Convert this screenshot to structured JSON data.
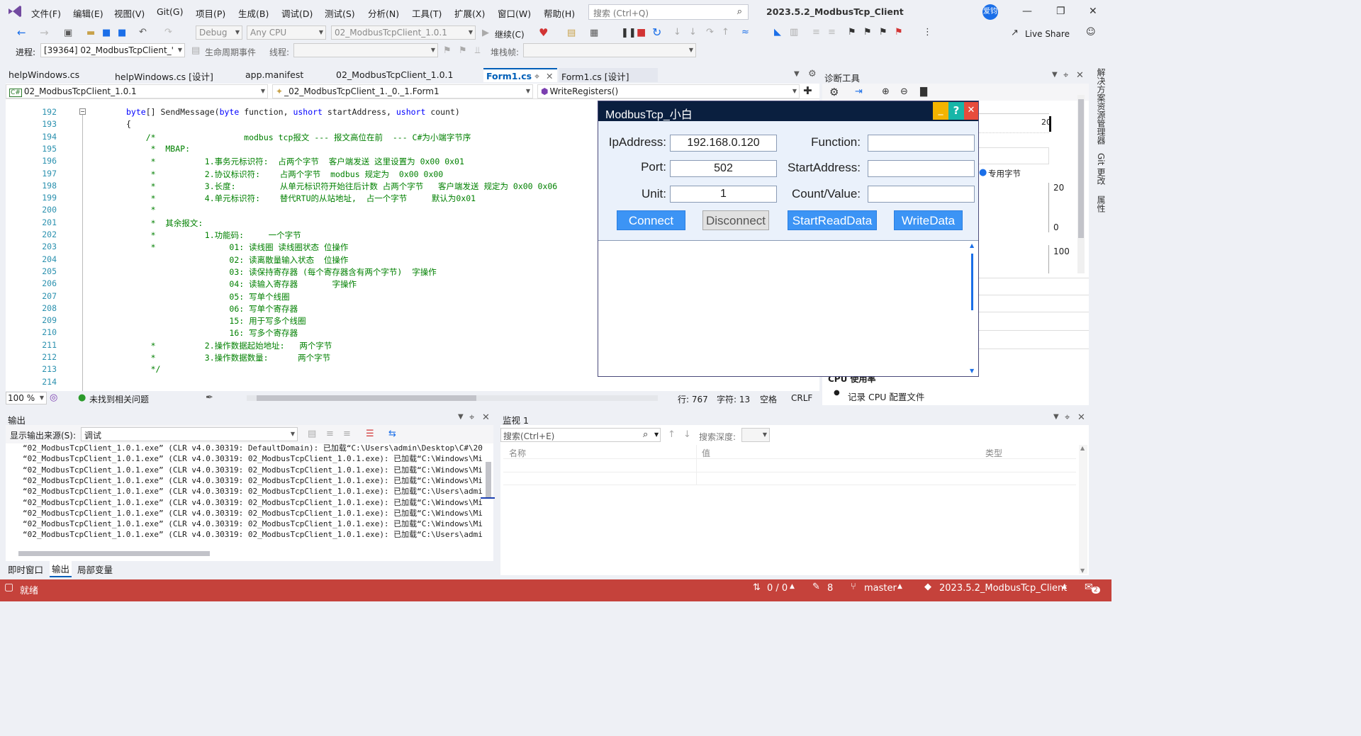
{
  "menu": [
    "文件(F)",
    "编辑(E)",
    "视图(V)",
    "Git(G)",
    "项目(P)",
    "生成(B)",
    "调试(D)",
    "测试(S)",
    "分析(N)",
    "工具(T)",
    "扩展(X)",
    "窗口(W)",
    "帮助(H)"
  ],
  "search_placeholder": "搜索 (Ctrl+Q)",
  "app_title": "2023.5.2_ModbusTcp_Client",
  "avatar": "爱钧",
  "toolbar": {
    "debug": "Debug",
    "cpu": "Any CPU",
    "project": "02_ModbusTcpClient_1.0.1",
    "continue": "继续(C)",
    "live_share": "Live Share",
    "process_label": "进程:",
    "process": "[39364] 02_ModbusTcpClient_'",
    "lifecycle": "生命周期事件",
    "thread_label": "线程:",
    "stack_label": "堆栈帧:"
  },
  "tabs": [
    "helpWindows.cs",
    "helpWindows.cs [设计]",
    "app.manifest",
    "02_ModbusTcpClient_1.0.1",
    "Form1.cs",
    "Form1.cs [设计]"
  ],
  "nav": {
    "project": "02_ModbusTcpClient_1.0.1",
    "class": "_02_ModbusTcpClient_1._0._1.Form1",
    "method": "WriteRegisters()"
  },
  "code": [
    {
      "n": "192",
      "t": "byte[] SendMessage(byte function, ushort startAddress, ushort count)"
    },
    {
      "n": "193",
      "t": "{"
    },
    {
      "n": "194",
      "t": "    /*                  modbus tcp报文 --- 报文高位在前  --- C#为小端字节序"
    },
    {
      "n": "195",
      "t": "     *  MBAP:"
    },
    {
      "n": "196",
      "t": "     *          1.事务元标识符:  占两个字节  客户端发送 这里设置为 0x00 0x01"
    },
    {
      "n": "197",
      "t": "     *          2.协议标识符:    占两个字节  modbus 规定为  0x00 0x00"
    },
    {
      "n": "198",
      "t": "     *          3.长度:         从单元标识符开始往后计数 占两个字节   客户端发送 规定为 0x00 0x06"
    },
    {
      "n": "199",
      "t": "     *          4.单元标识符:    替代RTU的从站地址,  占一个字节     默认为0x01"
    },
    {
      "n": "200",
      "t": "     *"
    },
    {
      "n": "201",
      "t": "     *  其余报文:"
    },
    {
      "n": "202",
      "t": "     *          1.功能码:     一个字节"
    },
    {
      "n": "203",
      "t": "     *               01: 读线圈 读线圈状态 位操作"
    },
    {
      "n": "204",
      "t": "                     02: 读离散量输入状态  位操作"
    },
    {
      "n": "205",
      "t": "                     03: 读保持寄存器 (每个寄存器含有两个字节)  字操作"
    },
    {
      "n": "206",
      "t": "                     04: 读输入寄存器       字操作"
    },
    {
      "n": "207",
      "t": "                     05: 写单个线圈"
    },
    {
      "n": "208",
      "t": "                     06: 写单个寄存器"
    },
    {
      "n": "209",
      "t": "                     15: 用于写多个线圈"
    },
    {
      "n": "210",
      "t": "                     16: 写多个寄存器"
    },
    {
      "n": "211",
      "t": "     *          2.操作数据起始地址:   两个字节"
    },
    {
      "n": "212",
      "t": "     *          3.操作数据数量:      两个字节"
    },
    {
      "n": "213",
      "t": "     */"
    },
    {
      "n": "214",
      "t": ""
    }
  ],
  "editor_status": {
    "zoom": "100 %",
    "issues": "未找到相关问题",
    "line": "行: 767",
    "char": "字符: 13",
    "space": "空格",
    "eol": "CRLF"
  },
  "diag": {
    "title": "诊断工具",
    "tick1": "20",
    "tick2": "20",
    "tick3": "0",
    "tick4": "100",
    "legend": "专用字节",
    "cpu_usage": "CPU 使用率",
    "record": "记录 CPU 配置文件"
  },
  "dialog": {
    "title": "ModbusTcp_小白",
    "labels": {
      "ip": "IpAddress:",
      "port": "Port:",
      "unit": "Unit:",
      "function": "Function:",
      "start": "StartAddress:",
      "count": "Count/Value:"
    },
    "values": {
      "ip": "192.168.0.120",
      "port": "502",
      "unit": "1",
      "function": "",
      "start": "",
      "count": ""
    },
    "buttons": {
      "connect": "Connect",
      "disconnect": "Disconnect",
      "read": "StartReadData",
      "write": "WriteData"
    }
  },
  "output": {
    "title": "输出",
    "source_label": "显示输出来源(S):",
    "source": "调试",
    "lines": [
      "“02_ModbusTcpClient_1.0.1.exe” (CLR v4.0.30319: DefaultDomain): 已加载“C:\\Users\\admin\\Desktop\\C#\\20",
      "“02_ModbusTcpClient_1.0.1.exe” (CLR v4.0.30319: 02_ModbusTcpClient_1.0.1.exe): 已加载“C:\\Windows\\Mi",
      "“02_ModbusTcpClient_1.0.1.exe” (CLR v4.0.30319: 02_ModbusTcpClient_1.0.1.exe): 已加载“C:\\Windows\\Mi",
      "“02_ModbusTcpClient_1.0.1.exe” (CLR v4.0.30319: 02_ModbusTcpClient_1.0.1.exe): 已加载“C:\\Windows\\Mi",
      "“02_ModbusTcpClient_1.0.1.exe” (CLR v4.0.30319: 02_ModbusTcpClient_1.0.1.exe): 已加载“C:\\Users\\admi",
      "“02_ModbusTcpClient_1.0.1.exe” (CLR v4.0.30319: 02_ModbusTcpClient_1.0.1.exe): 已加载“C:\\Windows\\Mi",
      "“02_ModbusTcpClient_1.0.1.exe” (CLR v4.0.30319: 02_ModbusTcpClient_1.0.1.exe): 已加载“C:\\Windows\\Mi",
      "“02_ModbusTcpClient_1.0.1.exe” (CLR v4.0.30319: 02_ModbusTcpClient_1.0.1.exe): 已加载“C:\\Windows\\Mi",
      "“02_ModbusTcpClient_1.0.1.exe” (CLR v4.0.30319: 02_ModbusTcpClient_1.0.1.exe): 已加载“C:\\Users\\admi"
    ],
    "bottom_tabs": [
      "即时窗口",
      "输出",
      "局部变量"
    ]
  },
  "watch": {
    "title": "监视 1",
    "search": "搜索(Ctrl+E)",
    "depth": "搜索深度:",
    "cols": [
      "名称",
      "值",
      "类型"
    ]
  },
  "right_tabs": [
    "解决方案资源管理器",
    "Git 更改",
    "属性"
  ],
  "status": {
    "ready": "就绪",
    "updown": "0 / 0",
    "pen": "8",
    "branch": "master",
    "repo": "2023.5.2_ModbusTcp_Client",
    "notif": "2"
  }
}
